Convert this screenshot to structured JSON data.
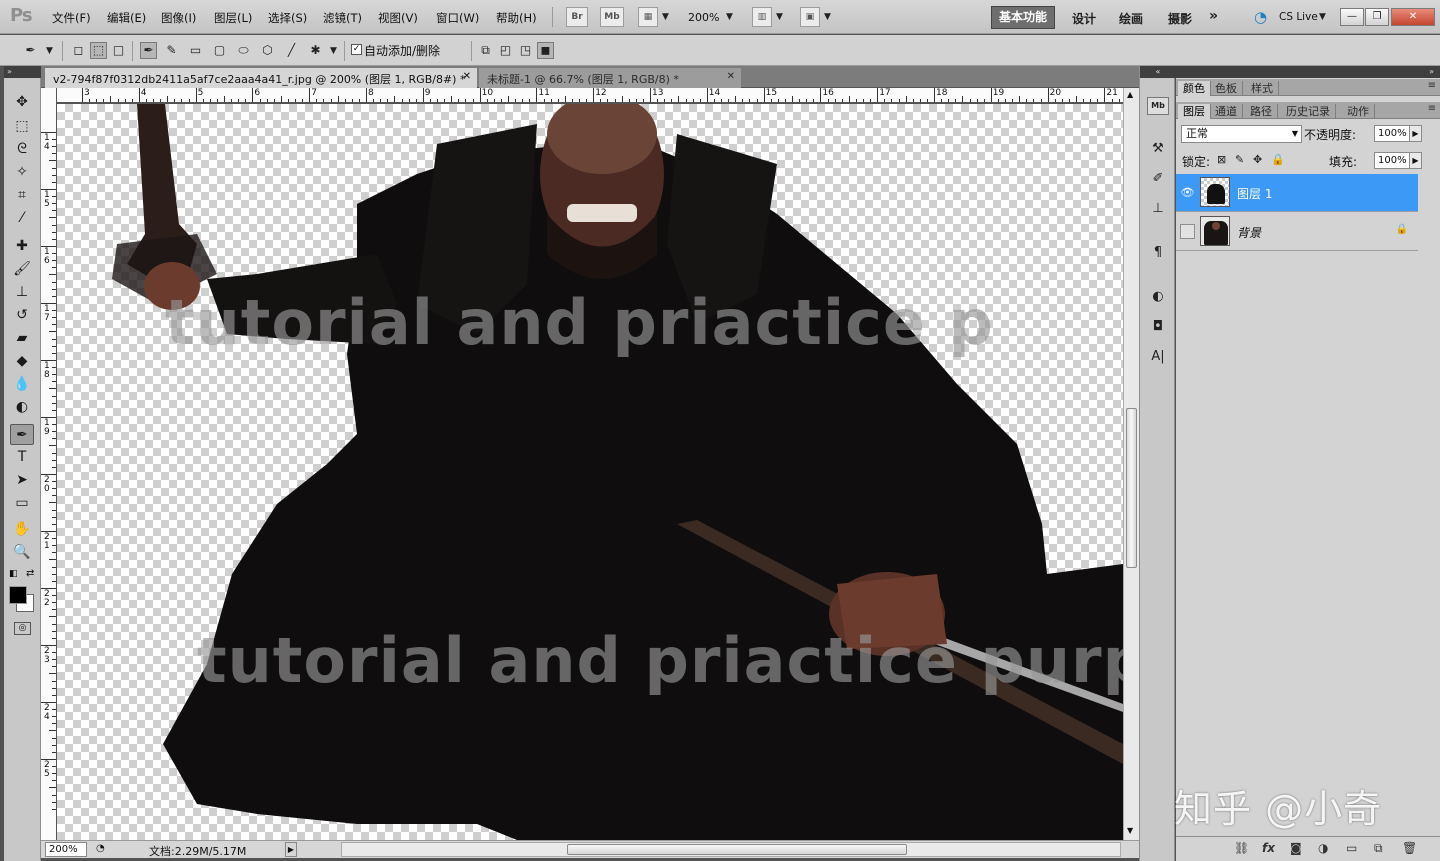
{
  "app": {
    "logo": "Ps"
  },
  "menubar": {
    "items": [
      "文件(F)",
      "编辑(E)",
      "图像(I)",
      "图层(L)",
      "选择(S)",
      "滤镜(T)",
      "视图(V)",
      "窗口(W)",
      "帮助(H)"
    ],
    "bridge_label": "Br",
    "minibridge_label": "Mb",
    "zoom": "200%",
    "workspaces": [
      "基本功能",
      "设计",
      "绘画",
      "摄影"
    ],
    "more": "»",
    "cslive": "CS Live",
    "window_buttons": {
      "minimize": "—",
      "restore": "❐",
      "close": "✕"
    }
  },
  "options": {
    "auto_add_delete_label": "自动添加/删除",
    "auto_add_delete_checked": true
  },
  "documents": {
    "tabs": [
      {
        "title": "v2-794f87f0312db2411a5af7ce2aaa4a41_r.jpg @ 200% (图层 1, RGB/8#) *",
        "active": true
      },
      {
        "title": "未标题-1 @ 66.7% (图层 1, RGB/8) *",
        "active": false
      }
    ],
    "close_glyph": "✕"
  },
  "rulers": {
    "horizontal": [
      "3",
      "4",
      "5",
      "6",
      "7",
      "8",
      "9",
      "10",
      "11",
      "12",
      "13",
      "14",
      "15",
      "16",
      "17",
      "18",
      "19",
      "20",
      "21"
    ],
    "vertical": [
      "1\n4",
      "1\n5",
      "1\n6",
      "1\n7",
      "1\n8",
      "1\n9",
      "2\n0",
      "2\n1",
      "2\n2",
      "2\n3",
      "2\n4",
      "2\n5"
    ]
  },
  "canvas": {
    "watermark_top": "tutorial and priactice p",
    "watermark_bottom": "tutorial and priactice purpos"
  },
  "status": {
    "zoom": "200%",
    "doc_info": "文档:2.29M/5.17M",
    "arrow": "▶"
  },
  "panels": {
    "top_tabs": [
      "颜色",
      "色板",
      "样式"
    ],
    "layer_tabs": [
      "图层",
      "通道",
      "路径",
      "历史记录",
      "动作"
    ],
    "panel_menu": "≡",
    "blend_mode": "正常",
    "opacity_label": "不透明度:",
    "opacity_value": "100%",
    "lock_label": "锁定:",
    "fill_label": "填充:",
    "fill_value": "100%",
    "layers": [
      {
        "name": "图层 1",
        "selected": true,
        "visible": true
      },
      {
        "name": "背景",
        "selected": false,
        "visible": false,
        "locked": true
      }
    ]
  },
  "overlay": {
    "zhihu_watermark": "知乎 @小奇"
  },
  "colors": {
    "selected_layer": "#3d99f6",
    "foreground": "#000000",
    "background": "#ffffff"
  }
}
